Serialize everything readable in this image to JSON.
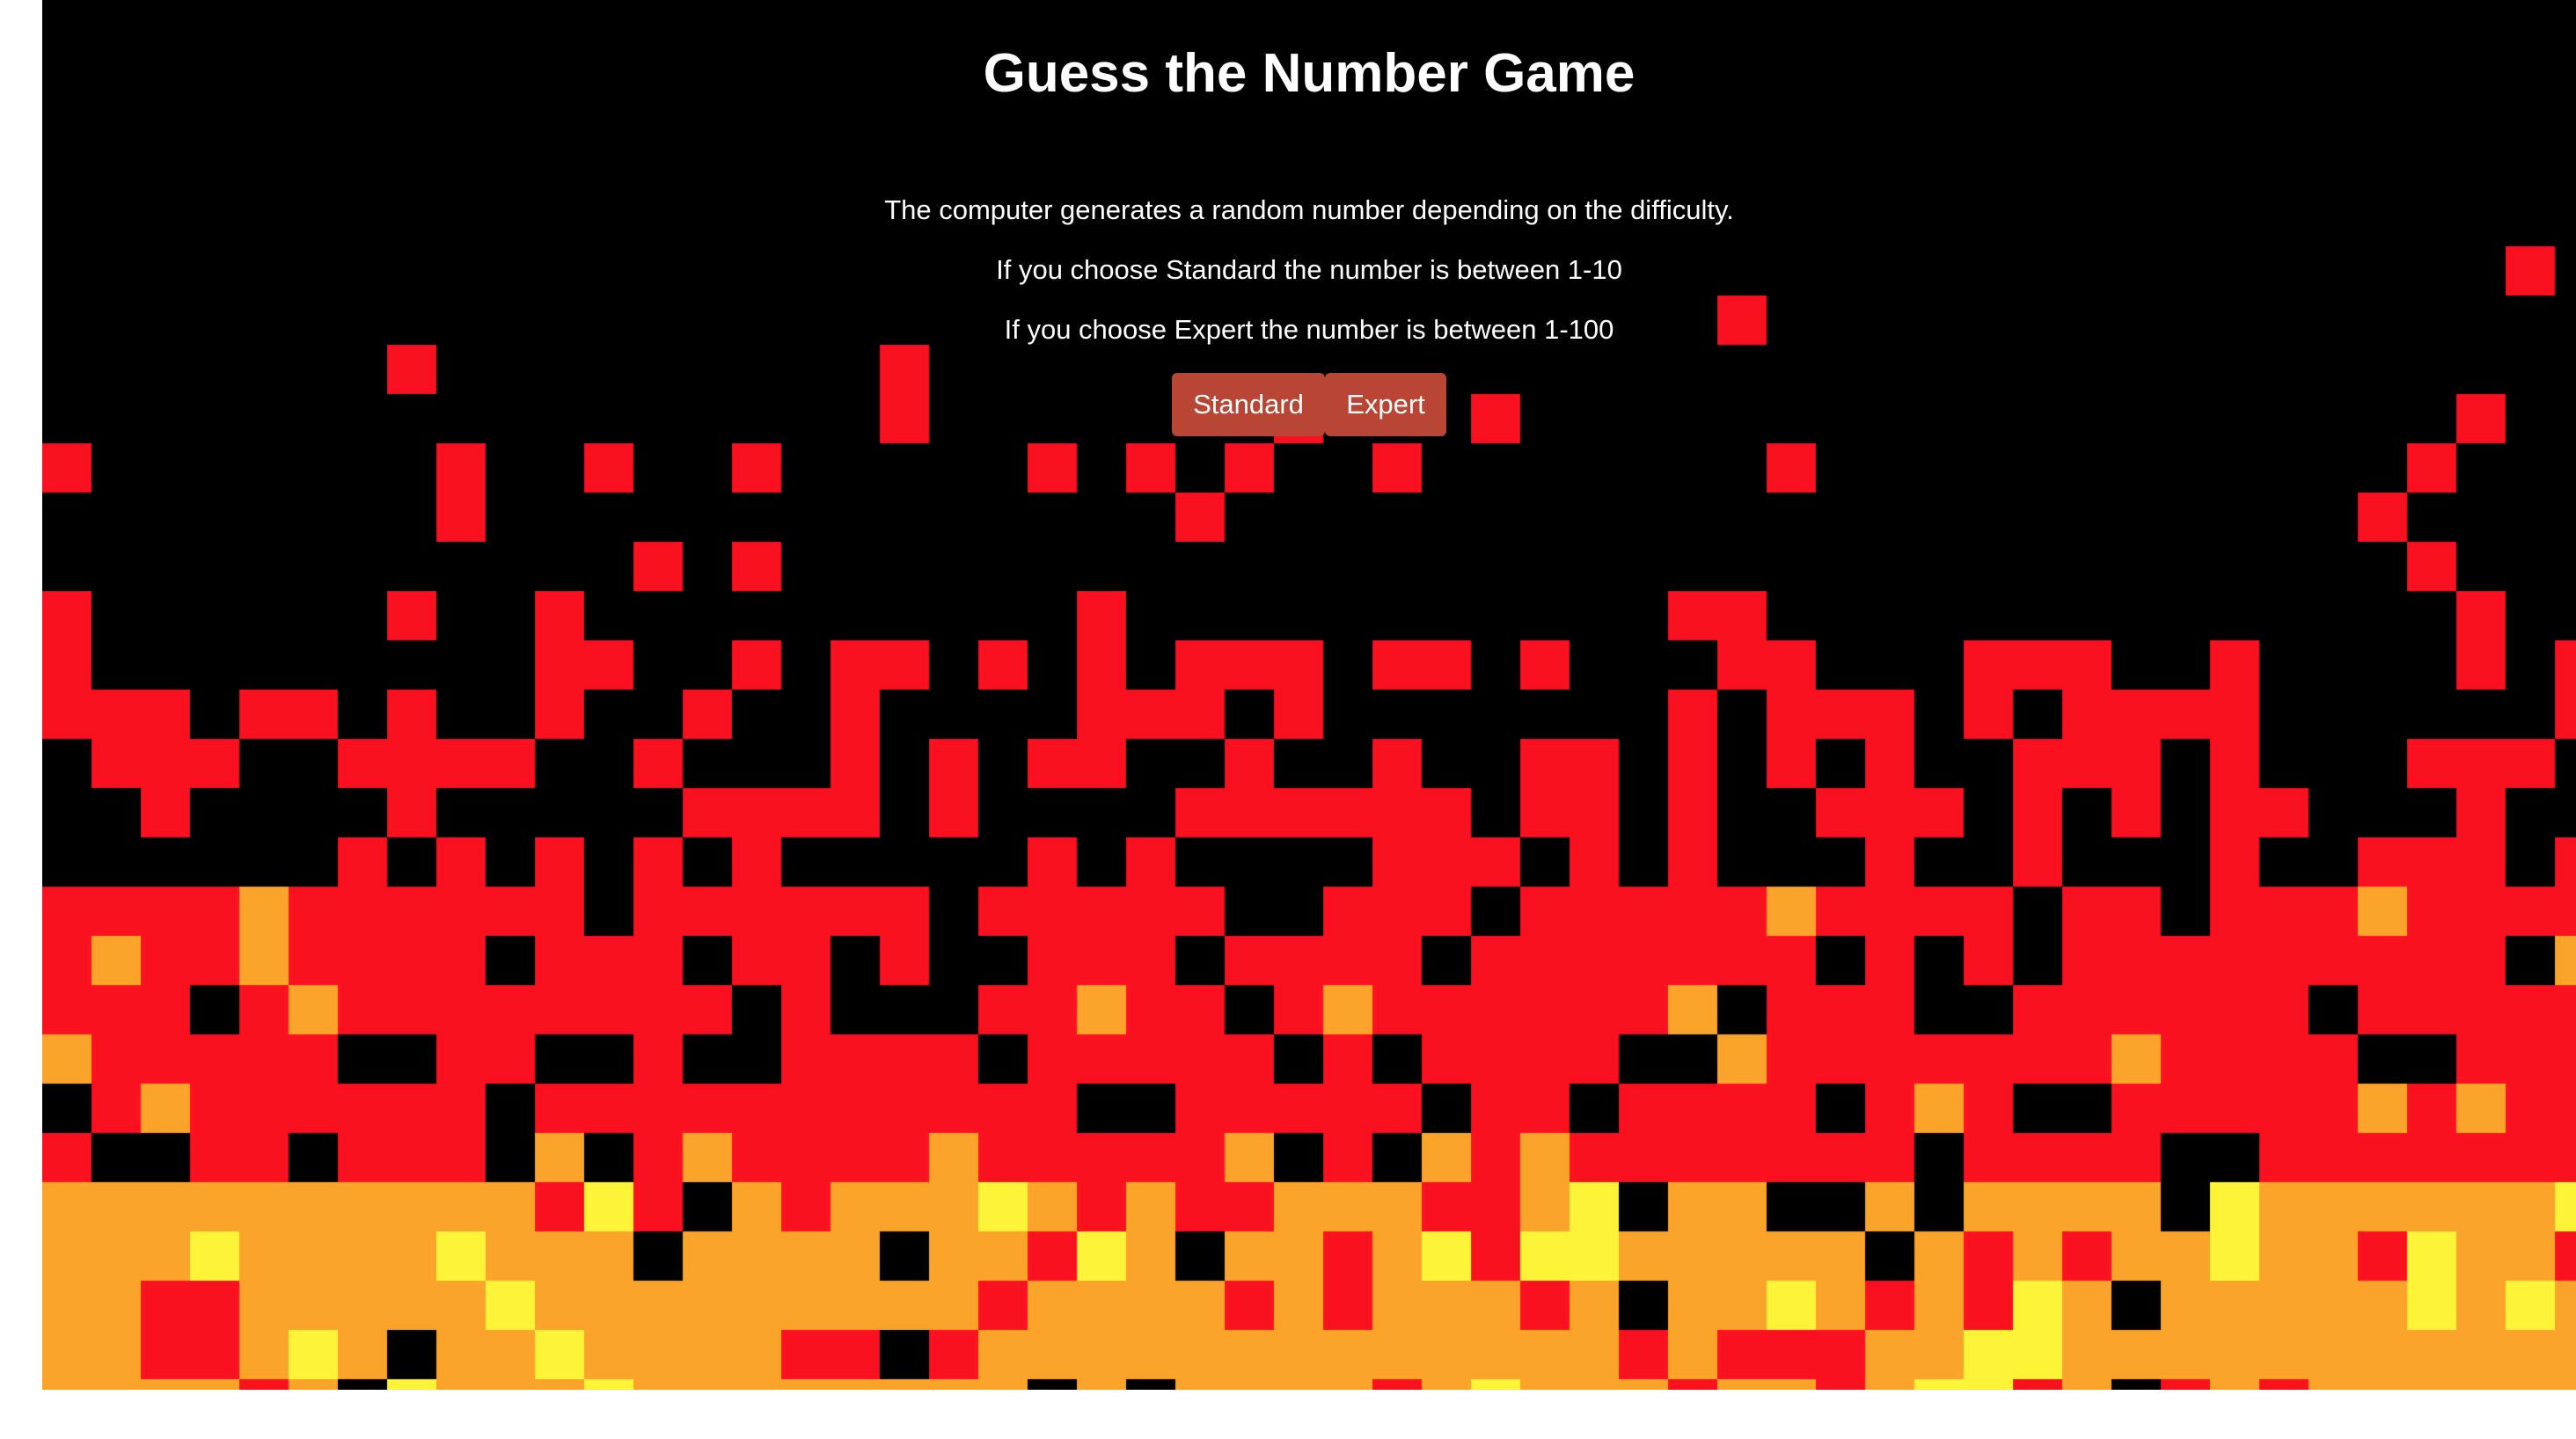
{
  "game": {
    "title": "Guess the Number Game",
    "description": [
      "The computer generates a random number depending on the difficulty.",
      "If you choose Standard the number is between 1-10",
      "If you choose Expert the number is between 1-100"
    ],
    "buttons": {
      "standard_label": "Standard",
      "expert_label": "Expert"
    }
  },
  "colors": {
    "background": "#000000",
    "button": "#b94634",
    "fire_red": "#fa111f",
    "fire_orange": "#fba42c",
    "fire_yellow": "#fdf43a",
    "text": "#ffffff"
  }
}
